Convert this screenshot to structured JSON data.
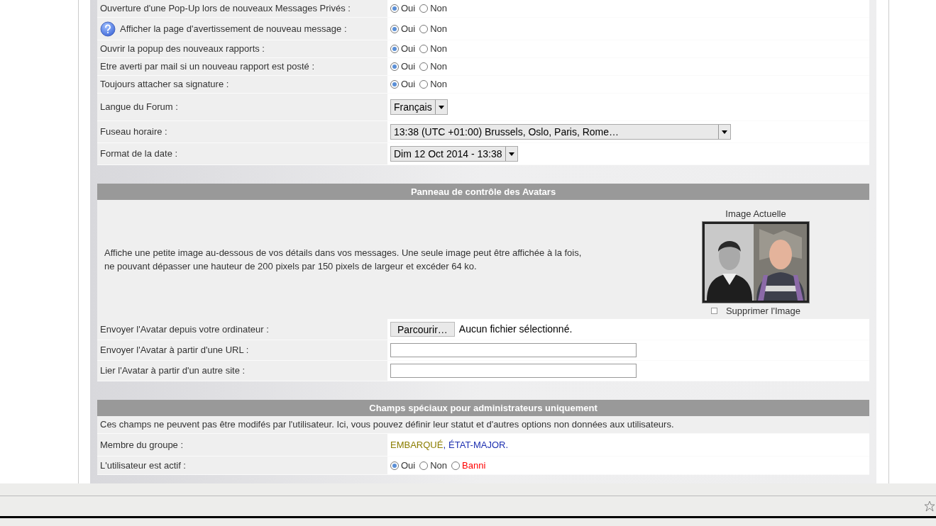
{
  "preferences": {
    "rows": [
      {
        "label": "Ouverture d'une Pop-Up lors de nouveaux Messages Privés :",
        "kind": "radio",
        "help_icon": false,
        "options": [
          {
            "label": "Oui",
            "selected": true
          },
          {
            "label": "Non",
            "selected": false
          }
        ]
      },
      {
        "label": "Afficher la page d'avertissement de nouveau message :",
        "kind": "radio",
        "help_icon": true,
        "options": [
          {
            "label": "Oui",
            "selected": true
          },
          {
            "label": "Non",
            "selected": false
          }
        ]
      },
      {
        "label": "Ouvrir la popup des nouveaux rapports :",
        "kind": "radio",
        "help_icon": false,
        "options": [
          {
            "label": "Oui",
            "selected": true
          },
          {
            "label": "Non",
            "selected": false
          }
        ]
      },
      {
        "label": "Etre averti par mail si un nouveau rapport est posté :",
        "kind": "radio",
        "help_icon": false,
        "options": [
          {
            "label": "Oui",
            "selected": true
          },
          {
            "label": "Non",
            "selected": false
          }
        ]
      },
      {
        "label": "Toujours attacher sa signature :",
        "kind": "radio",
        "help_icon": false,
        "options": [
          {
            "label": "Oui",
            "selected": true
          },
          {
            "label": "Non",
            "selected": false
          }
        ]
      },
      {
        "label": "Langue du Forum :",
        "kind": "select",
        "help_icon": false,
        "value": "Français"
      },
      {
        "label": "Fuseau horaire :",
        "kind": "select",
        "help_icon": false,
        "value": "13:38 (UTC +01:00) Brussels, Oslo, Paris, Rome…"
      },
      {
        "label": "Format de la date :",
        "kind": "select",
        "help_icon": false,
        "value": "Dim 12 Oct 2014 - 13:38"
      }
    ]
  },
  "avatar_panel": {
    "title": "Panneau de contrôle des Avatars",
    "description": "Affiche une petite image au-dessous de vos détails dans vos messages. Une seule image peut être affichée à la fois, ne pouvant dépasser une hauteur de 200 pixels par 150 pixels de largeur et excéder 64 ko.",
    "current_image_label": "Image Actuelle",
    "delete_image": {
      "label": "Supprimer l'Image",
      "checked": false
    },
    "rows": [
      {
        "label": "Envoyer l'Avatar depuis votre ordinateur :",
        "kind": "file",
        "button": "Parcourir…",
        "status": "Aucun fichier sélectionné."
      },
      {
        "label": "Envoyer l'Avatar à partir d'une URL :",
        "kind": "text"
      },
      {
        "label": "Lier l'Avatar à partir d'un autre site :",
        "kind": "text"
      }
    ]
  },
  "admin_panel": {
    "title": "Champs spéciaux pour administrateurs uniquement",
    "note": "Ces champs ne peuvent pas être modifés par l'utilisateur. Ici, vous pouvez définir leur statut et d'autres options non données aux utilisateurs.",
    "rows": [
      {
        "label": "Membre du groupe :",
        "kind": "groups",
        "groups": [
          {
            "name": "EMBARQUÉ",
            "color": "#8b7d00",
            "suffix": ","
          },
          {
            "name": "ÉTAT-MAJOR",
            "color": "#1c2fb0",
            "suffix": "."
          }
        ]
      },
      {
        "label": "L'utilisateur est actif :",
        "kind": "radio",
        "options": [
          {
            "label": "Oui",
            "selected": true,
            "color": "#333333"
          },
          {
            "label": "Non",
            "selected": false,
            "color": "#333333"
          },
          {
            "label": "Banni",
            "selected": false,
            "color": "#ff0000"
          }
        ]
      }
    ]
  }
}
